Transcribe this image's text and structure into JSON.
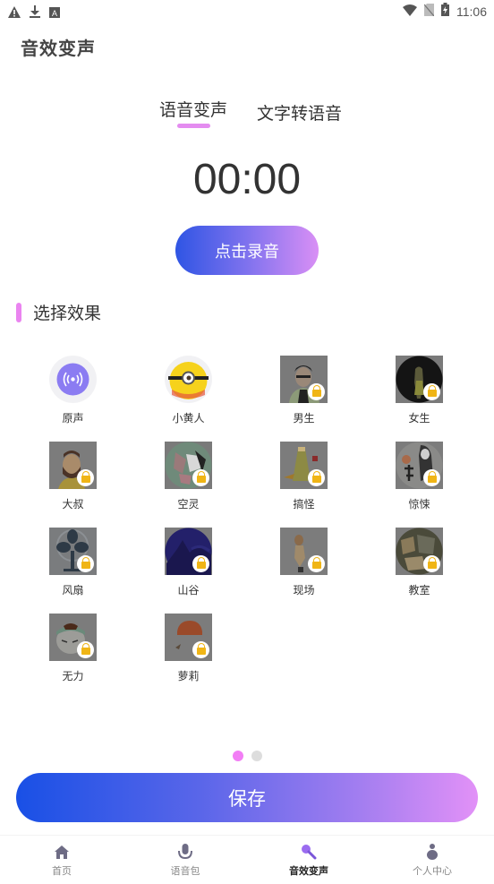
{
  "status_bar": {
    "time": "11:06",
    "left_icons": [
      "warning-icon",
      "download-icon",
      "a-box-icon"
    ],
    "right_icons": [
      "wifi-icon",
      "no-sim-icon",
      "battery-charging-icon"
    ]
  },
  "header": {
    "title": "音效变声"
  },
  "tabs": [
    {
      "label": "语音变声",
      "active": true
    },
    {
      "label": "文字转语音",
      "active": false
    }
  ],
  "timer": {
    "value": "00:00"
  },
  "record_button": {
    "label": "点击录音"
  },
  "section": {
    "title": "选择效果"
  },
  "effects": [
    {
      "label": "原声",
      "icon": "broadcast-icon",
      "locked": false,
      "selected": true
    },
    {
      "label": "小黄人",
      "icon": "minion-icon",
      "locked": false
    },
    {
      "label": "男生",
      "icon": "man-avatar",
      "locked": true
    },
    {
      "label": "女生",
      "icon": "woman-avatar",
      "locked": true
    },
    {
      "label": "大叔",
      "icon": "uncle-avatar",
      "locked": true
    },
    {
      "label": "空灵",
      "icon": "ethereal-avatar",
      "locked": true
    },
    {
      "label": "搞怪",
      "icon": "funny-avatar",
      "locked": true
    },
    {
      "label": "惊悚",
      "icon": "horror-avatar",
      "locked": true
    },
    {
      "label": "风扇",
      "icon": "fan-avatar",
      "locked": true
    },
    {
      "label": "山谷",
      "icon": "valley-avatar",
      "locked": true
    },
    {
      "label": "现场",
      "icon": "live-avatar",
      "locked": true
    },
    {
      "label": "教室",
      "icon": "classroom-avatar",
      "locked": true
    },
    {
      "label": "无力",
      "icon": "weak-avatar",
      "locked": true
    },
    {
      "label": "萝莉",
      "icon": "loli-avatar",
      "locked": true
    }
  ],
  "pagination": {
    "pages": 2,
    "current": 1,
    "active_color": "#f27ef5",
    "inactive_color": "#dddddd"
  },
  "save_button": {
    "label": "保存"
  },
  "bottom_nav": [
    {
      "label": "首页",
      "icon": "home-icon",
      "active": false
    },
    {
      "label": "语音包",
      "icon": "microphone-icon",
      "active": false
    },
    {
      "label": "音效变声",
      "icon": "karaoke-mic-icon",
      "active": true
    },
    {
      "label": "个人中心",
      "icon": "person-icon",
      "active": false
    }
  ],
  "colors": {
    "accent_pink": "#e48cf0",
    "gradient_start": "#1950e6",
    "gradient_end": "#e291f7",
    "lock": "#f0b516"
  }
}
